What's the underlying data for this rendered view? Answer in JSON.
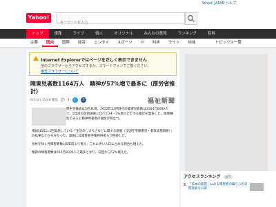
{
  "topbar": {
    "links": "Yahoo! JAPAN ヘルプ"
  },
  "header": {
    "logo": "Yahoo!",
    "search_placeholder": "キーワードを入力"
  },
  "nav_primary": [
    "トップ",
    "速報",
    "ライブ",
    "個人",
    "オリジナル",
    "みんなの意見",
    "ランキング",
    "有料"
  ],
  "nav_secondary": [
    "主要",
    "国内",
    "国際",
    "経済",
    "エンタメ",
    "スポーツ",
    "IT",
    "科学",
    "ライフ",
    "地域"
  ],
  "nav_secondary_right": "トピックス一覧",
  "notice": {
    "title": "Internet Explorerではページを正しく表示できません",
    "body": "他のブラウザーからアクセスするか、スマートフォンでご覧ください。",
    "link": "推奨ブラウザーについて"
  },
  "article": {
    "title": "障害児者数1164万人　精神が57%増で最多に（厚労省推計）",
    "date": "6/1(火) 15:46 配信",
    "comments": "4",
    "source": "福祉新聞",
    "paragraphs": [
      "厚生労働省は5月31日、2022年12月時点の障害児者数は1164万6000人で、5年前の前回調査に比べて24・3%増えたとする推計を発表した。障害種別でみると精神障害者の増加が目立つ。",
      "増加は5年に1回実施している「生活のしづらさなどに関する調査（全国在宅障害児・者等実態調査）」の結果などから分かった。調査には障害者手帳所持者らが回答した。",
      "身体を除く各障害者数は5年前より増え、これに伴い人口に占める割合も増えた。",
      "精神の障害者数は614万8000人で最多となり、前回から57%増えた。"
    ]
  },
  "ranking": {
    "title": "アクセスランキング",
    "subtitle": "（国内）",
    "items": [
      {
        "rank": "1",
        "text": "「日本の家庭」にみる障害者の暮らしの実態調査を公表"
      }
    ]
  },
  "colors": {
    "accent": "#ff0033",
    "link": "#0a64a4",
    "warn": "#f2a200"
  }
}
